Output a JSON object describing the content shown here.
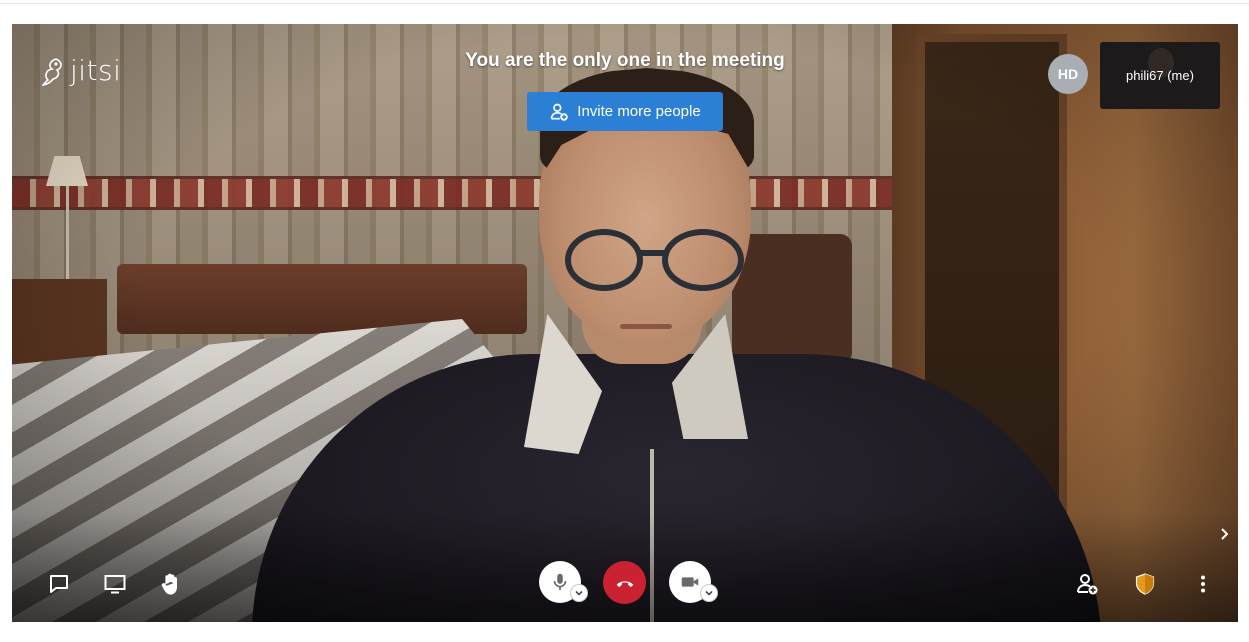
{
  "app": {
    "logo_text": "jitsi"
  },
  "meeting": {
    "notice": "You are the only one in the meeting",
    "invite_label": "Invite more people"
  },
  "participants": {
    "remote_initials": "HD",
    "local_name": "phili67 (me)"
  },
  "toolbar": {
    "left": [
      "chat-icon",
      "screenshare-icon",
      "raise-hand-icon"
    ],
    "center": [
      "microphone-icon",
      "hangup-icon",
      "camera-icon"
    ],
    "right": [
      "invite-person-icon",
      "security-shield-icon",
      "more-options-icon"
    ]
  },
  "colors": {
    "invite_button": "#2b7fd4",
    "hangup": "#cb2233",
    "shield": "#e69a1a",
    "avatar_bg": "#a9aeb4"
  }
}
